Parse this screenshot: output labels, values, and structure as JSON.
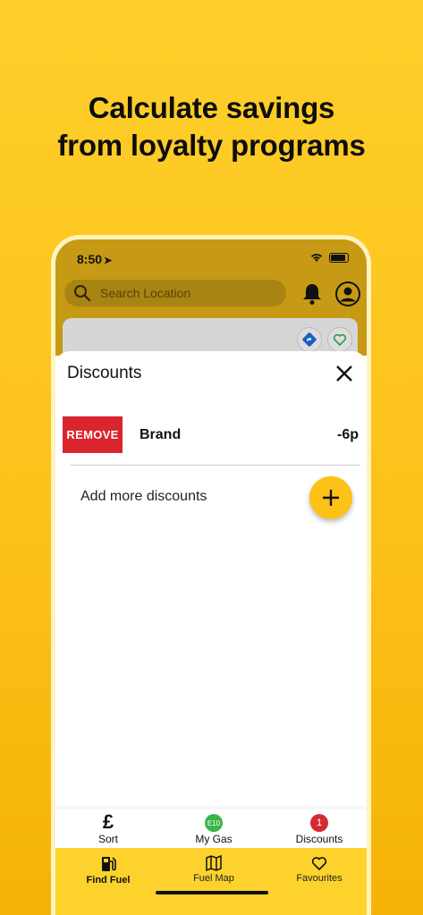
{
  "headline": {
    "line1": "Calculate savings",
    "line2": "from loyalty programs"
  },
  "status_bar": {
    "time": "8:50"
  },
  "search": {
    "placeholder": "Search Location"
  },
  "sheet": {
    "title": "Discounts",
    "discounts": [
      {
        "remove_label": "REMOVE",
        "name": "Brand",
        "amount": "-6p"
      }
    ],
    "add_more_label": "Add more discounts"
  },
  "sub_tabs": [
    {
      "label": "Sort",
      "icon": "pound-icon",
      "glyph": "£"
    },
    {
      "label": "My Gas",
      "icon": "fuel-grade-badge",
      "badge": "E10"
    },
    {
      "label": "Discounts",
      "icon": "discount-count-badge",
      "badge": "1"
    }
  ],
  "bottom_nav": [
    {
      "label": "Find Fuel",
      "icon": "fuel-pump-icon",
      "active": true
    },
    {
      "label": "Fuel Map",
      "icon": "map-icon",
      "active": false
    },
    {
      "label": "Favourites",
      "icon": "heart-icon",
      "active": false
    }
  ],
  "colors": {
    "brand_yellow": "#fcc218",
    "remove_red": "#da252e",
    "e10_green": "#3bb54a"
  }
}
